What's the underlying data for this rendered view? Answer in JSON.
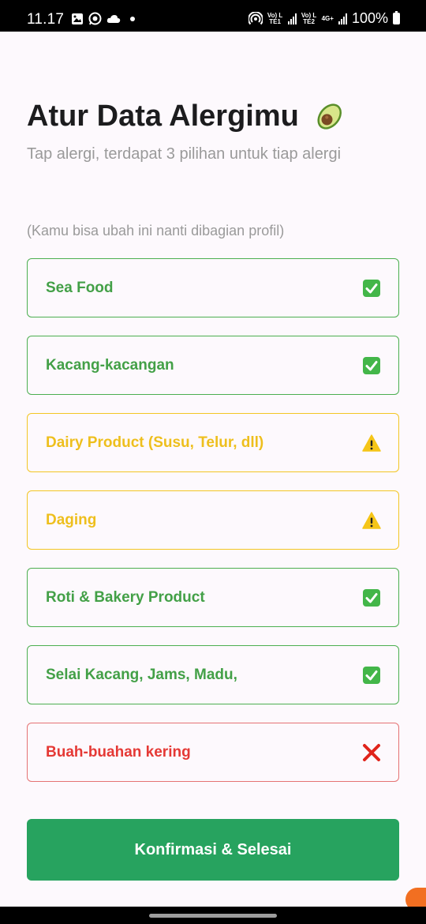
{
  "status_bar": {
    "time": "11.17",
    "network1": "Vo) LTE1",
    "network2": "Vo) LTE2",
    "network3": "4G+",
    "battery": "100%"
  },
  "header": {
    "title": "Atur Data Alergimu",
    "subtitle": "Tap alergi, terdapat 3 pilihan untuk tiap alergi"
  },
  "hint": "(Kamu bisa ubah ini nanti dibagian profil)",
  "allergies": [
    {
      "label": "Sea Food",
      "status": "safe"
    },
    {
      "label": "Kacang-kacangan",
      "status": "safe"
    },
    {
      "label": "Dairy Product (Susu, Telur, dll)",
      "status": "warning"
    },
    {
      "label": "Daging",
      "status": "warning"
    },
    {
      "label": "Roti & Bakery Product",
      "status": "safe"
    },
    {
      "label": "Selai Kacang, Jams, Madu,",
      "status": "safe"
    },
    {
      "label": "Buah-buahan kering",
      "status": "danger"
    }
  ],
  "status_icons": {
    "safe": "check-box-icon",
    "warning": "warning-icon",
    "danger": "cross-icon"
  },
  "colors": {
    "safe": "#43a047",
    "warning": "#eebf1d",
    "danger": "#e53935",
    "primary_button": "#27a35f"
  },
  "confirm_button": "Konfirmasi & Selesai"
}
